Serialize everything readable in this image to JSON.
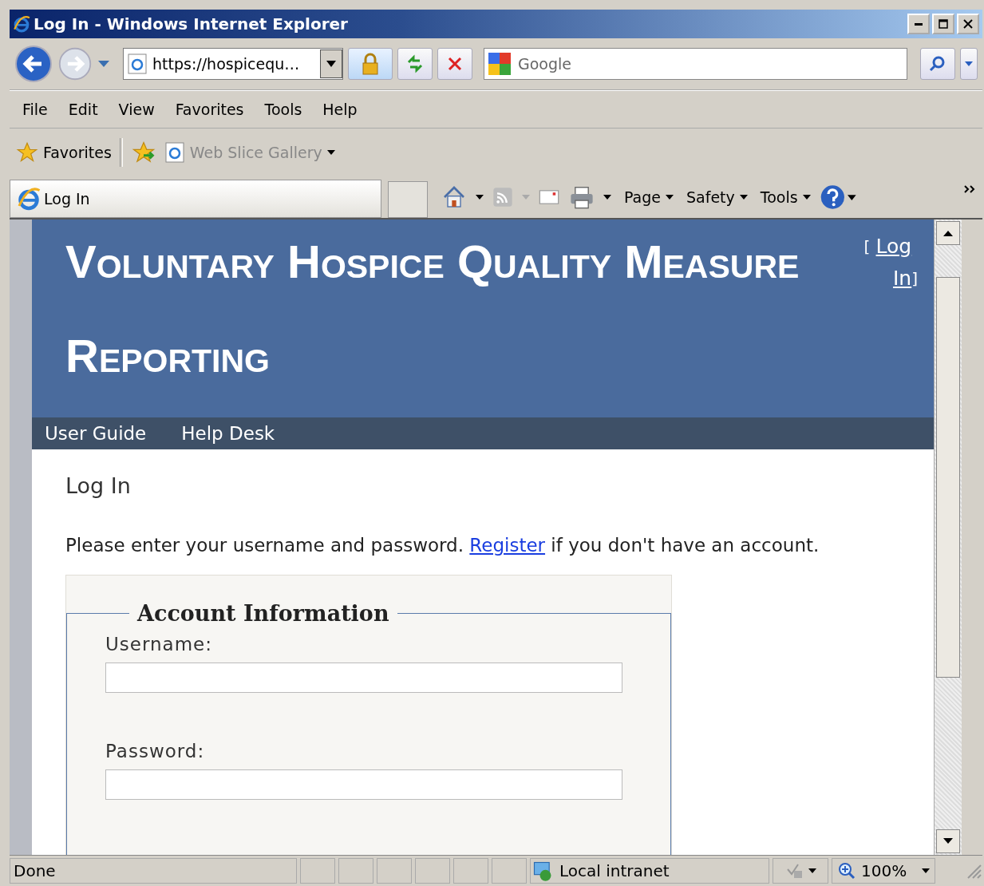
{
  "window": {
    "title": "Log In - Windows Internet Explorer"
  },
  "address_bar": {
    "value": "https://hospicequ…"
  },
  "search": {
    "placeholder": "Google"
  },
  "menu": [
    "File",
    "Edit",
    "View",
    "Favorites",
    "Tools",
    "Help"
  ],
  "favorites_bar": {
    "favorites": "Favorites",
    "web_slice": "Web Slice Gallery"
  },
  "tab": {
    "title": "Log In"
  },
  "command_bar": [
    "Page",
    "Safety",
    "Tools"
  ],
  "page": {
    "site_title": "Voluntary Hospice Quality Measure Reporting",
    "login_link": {
      "open": "[",
      "label": "Log In",
      "close": "]"
    },
    "nav": [
      "User Guide",
      "Help Desk"
    ],
    "heading": "Log In",
    "instructions": {
      "before": "Please enter your username and password.",
      "link": "Register",
      "after": "if you don't have an account."
    },
    "legend": "Account Information",
    "fields": [
      {
        "label": "Username:"
      },
      {
        "label": "Password:"
      }
    ]
  },
  "status_bar": {
    "text": "Done",
    "zone": "Local intranet",
    "zoom": "100%"
  }
}
